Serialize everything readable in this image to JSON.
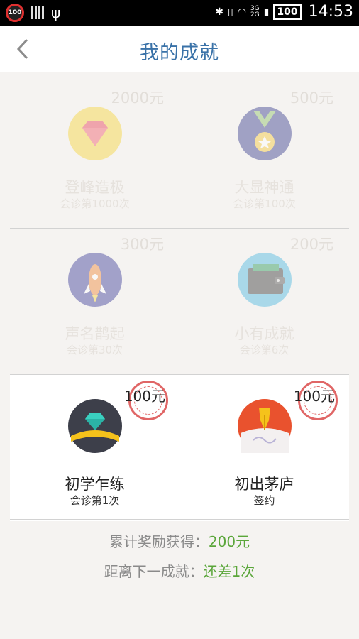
{
  "statusbar": {
    "badge": "100",
    "net_top": "3G",
    "net_bottom": "2G",
    "battery": "100",
    "time": "14:53"
  },
  "header": {
    "title": "我的成就"
  },
  "achievements": [
    {
      "name": "登峰造极",
      "condition": "会诊第1000次",
      "reward": "2000元",
      "icon": "diamond-icon",
      "unlocked": false
    },
    {
      "name": "大显神通",
      "condition": "会诊第100次",
      "reward": "500元",
      "icon": "medal-icon",
      "unlocked": false
    },
    {
      "name": "声名鹊起",
      "condition": "会诊第30次",
      "reward": "300元",
      "icon": "rocket-icon",
      "unlocked": false
    },
    {
      "name": "小有成就",
      "condition": "会诊第6次",
      "reward": "200元",
      "icon": "wallet-icon",
      "unlocked": false
    },
    {
      "name": "初学乍练",
      "condition": "会诊第1次",
      "reward": "100元",
      "icon": "gem-icon",
      "unlocked": true
    },
    {
      "name": "初出茅庐",
      "condition": "签约",
      "reward": "100元",
      "icon": "pen-nib-icon",
      "unlocked": true
    }
  ],
  "summary": {
    "total_label": "累计奖励获得：",
    "total_value": "200元",
    "next_label": "距离下一成就：",
    "next_value": "还差1次"
  },
  "colors": {
    "accent": "#3a72a8",
    "highlight": "#5aa63a",
    "stamp": "#d94040"
  }
}
